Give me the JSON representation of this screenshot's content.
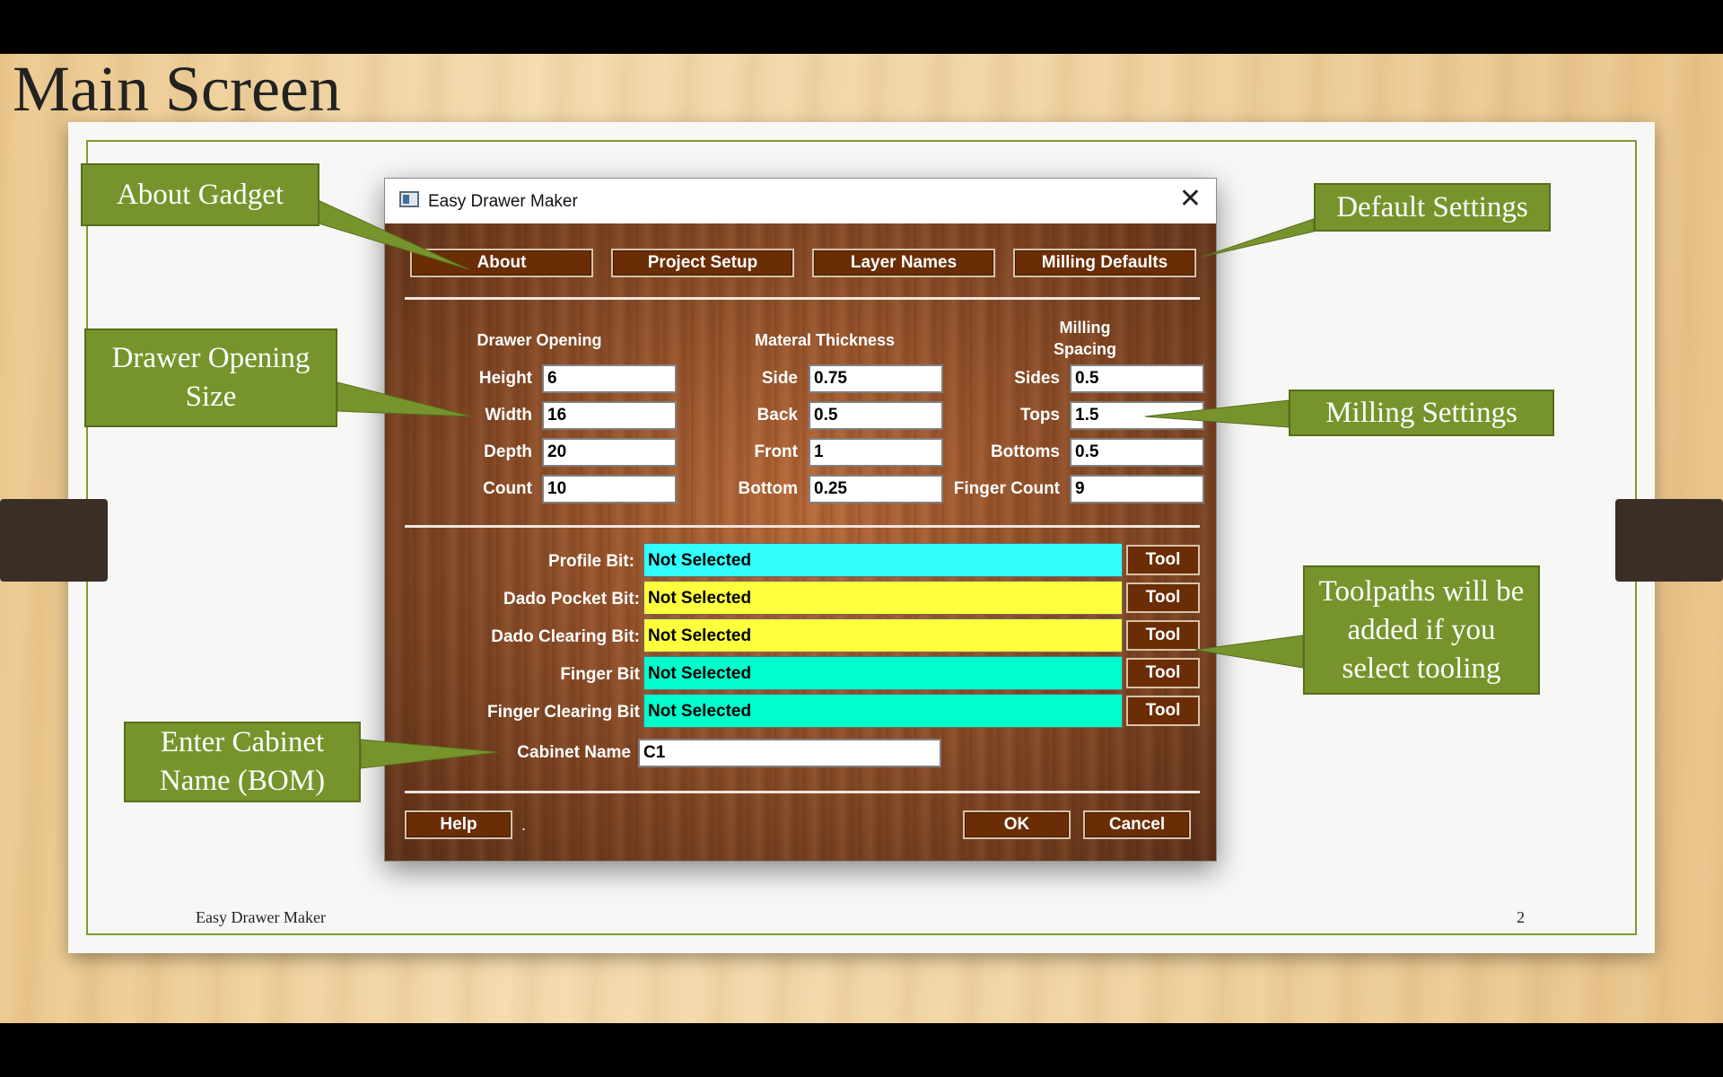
{
  "slide": {
    "title": "Main Screen",
    "footer_left": "Easy Drawer Maker",
    "page_number": "2"
  },
  "callouts": {
    "about": "About Gadget",
    "default": "Default Settings",
    "drawer": "Drawer Opening Size",
    "milling": "Milling Settings",
    "toolpaths": "Toolpaths will be added if you select tooling",
    "cabinet": "Enter Cabinet Name (BOM)"
  },
  "dialog": {
    "title": "Easy Drawer Maker",
    "close_icon": "close-icon",
    "top_buttons": [
      "About",
      "Project Setup",
      "Layer Names",
      "Milling Defaults"
    ],
    "drawer_opening": {
      "header": "Drawer Opening",
      "rows": [
        {
          "label": "Height",
          "value": "6"
        },
        {
          "label": "Width",
          "value": "16"
        },
        {
          "label": "Depth",
          "value": "20"
        },
        {
          "label": "Count",
          "value": "10"
        }
      ]
    },
    "material_thickness": {
      "header": "Materal Thickness",
      "rows": [
        {
          "label": "Side",
          "value": "0.75"
        },
        {
          "label": "Back",
          "value": "0.5"
        },
        {
          "label": "Front",
          "value": "1"
        },
        {
          "label": "Bottom",
          "value": "0.25"
        }
      ]
    },
    "milling_spacing": {
      "header_line1": "Milling",
      "header_line2": "Spacing",
      "rows": [
        {
          "label": "Sides",
          "value": "0.5"
        },
        {
          "label": "Tops",
          "value": "1.5"
        },
        {
          "label": "Bottoms",
          "value": "0.5"
        },
        {
          "label": "Finger Count",
          "value": "9"
        }
      ]
    },
    "bits": [
      {
        "label": "Profile Bit:",
        "value": "Not Selected",
        "color": "#33ffff",
        "tool": "Tool"
      },
      {
        "label": "Dado Pocket Bit:",
        "value": "Not Selected",
        "color": "#ffff3d",
        "tool": "Tool"
      },
      {
        "label": "Dado Clearing Bit:",
        "value": "Not Selected",
        "color": "#ffff3d",
        "tool": "Tool"
      },
      {
        "label": "Finger Bit",
        "value": "Not Selected",
        "color": "#00ffcc",
        "tool": "Tool"
      },
      {
        "label": "Finger Clearing Bit",
        "value": "Not Selected",
        "color": "#00ffcc",
        "tool": "Tool"
      }
    ],
    "cabinet": {
      "label": "Cabinet Name",
      "value": "C1"
    },
    "bottom_buttons": {
      "help": "Help",
      "dot": ".",
      "ok": "OK",
      "cancel": "Cancel"
    }
  }
}
